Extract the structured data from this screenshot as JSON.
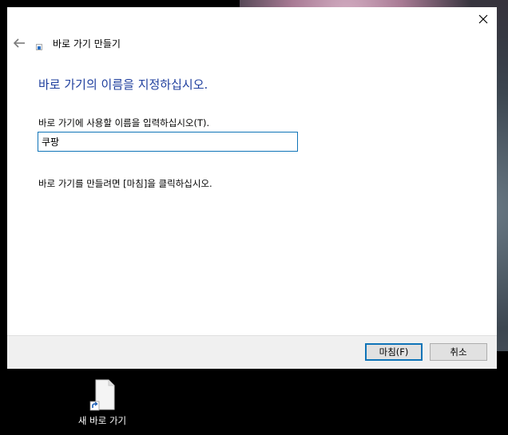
{
  "window": {
    "title": "바로 가기 만들기",
    "close_glyph": "✕"
  },
  "main": {
    "heading": "바로 가기의 이름을 지정하십시오.",
    "name_prompt": "바로 가기에 사용할 이름을 입력하십시오(T).",
    "name_value": "쿠팡",
    "hint": "바로 가기를 만들려면 [마침]을 클릭하십시오."
  },
  "footer": {
    "finish_label": "마침(F)",
    "cancel_label": "취소"
  },
  "desktop": {
    "icon_label": "새 바로 가기"
  },
  "colors": {
    "accent": "#0f74b8",
    "heading": "#1f3f9e",
    "footer_bg": "#f0f0f0"
  },
  "icons": {
    "back": "arrow-left-icon",
    "close": "close-icon",
    "title": "shortcut-icon",
    "desktop_item": "shortcut-file-icon"
  }
}
